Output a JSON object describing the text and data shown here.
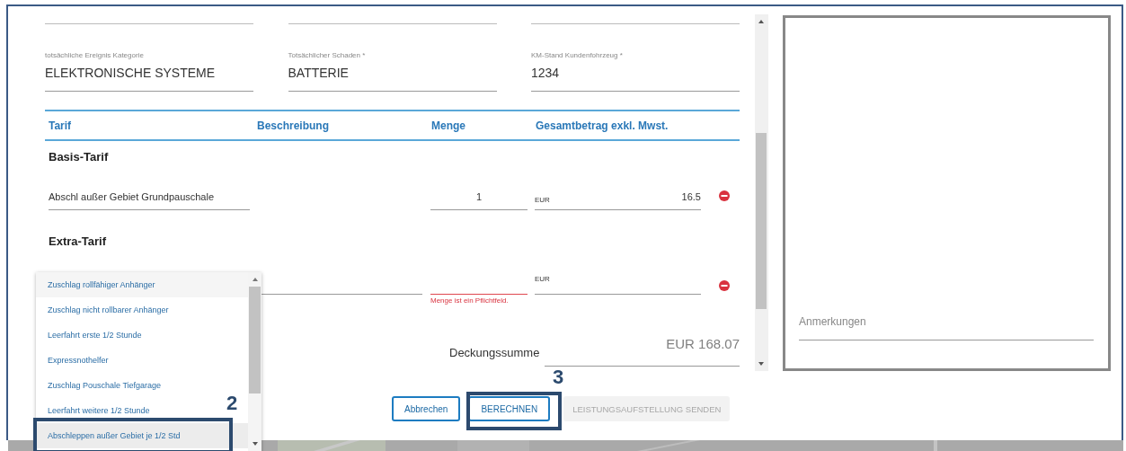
{
  "fields": [
    {
      "label": "totsächliche Ereignis Kategorie",
      "value": "ELEKTRONISCHE SYSTEME"
    },
    {
      "label": "Totsächlicher Schaden *",
      "value": "BATTERIE"
    },
    {
      "label": "KM-Stand Kundenfohrzeug *",
      "value": "1234"
    }
  ],
  "table": {
    "columns": [
      "Tarif",
      "Beschreibung",
      "Menge",
      "Gesamtbetrag exkl. Mwst."
    ],
    "groups": [
      {
        "title": "Basis-Tarif",
        "rows": [
          {
            "kind": "text",
            "description": "Abschl außer Gebiet Grundpauschale",
            "quantity": "1",
            "currency": "EUR",
            "amount": "16.5"
          }
        ]
      },
      {
        "title": "Extra-Tarif",
        "rows": [
          {
            "kind": "select",
            "currency": "EUR",
            "error": "Menge ist ein Pflichtfeld."
          }
        ]
      }
    ]
  },
  "total": {
    "label": "Deckungssumme",
    "value": "EUR 168.07"
  },
  "buttons": [
    {
      "label": "Abbrechen",
      "disabled": false
    },
    {
      "label": "BERECHNEN",
      "disabled": false
    },
    {
      "label": "LEISTUNGSAUFSTELLUNG SENDEN",
      "disabled": true
    }
  ],
  "notes": {
    "label": "Anmerkungen"
  },
  "dropdown": {
    "items": [
      {
        "label": "Zuschlag rollfähiger Anhänger",
        "selected": true,
        "hovered": false
      },
      {
        "label": "Zuschlag nicht rollbarer Anhänger",
        "selected": false,
        "hovered": false
      },
      {
        "label": "Leerfahrt erste 1/2 Stunde",
        "selected": false,
        "hovered": false
      },
      {
        "label": "Expressnothelfer",
        "selected": false,
        "hovered": false
      },
      {
        "label": "Zuschlag Pouschale Tiefgarage",
        "selected": false,
        "hovered": false
      },
      {
        "label": "Leerfahrt weitere 1/2 Stunde",
        "selected": false,
        "hovered": false
      },
      {
        "label": "Abschleppen außer Gebiet je 1/2 Std",
        "selected": false,
        "hovered": true
      }
    ]
  },
  "annotations": [
    {
      "number": "2",
      "kind": "dropdown-item"
    },
    {
      "number": "3",
      "kind": "button"
    }
  ]
}
